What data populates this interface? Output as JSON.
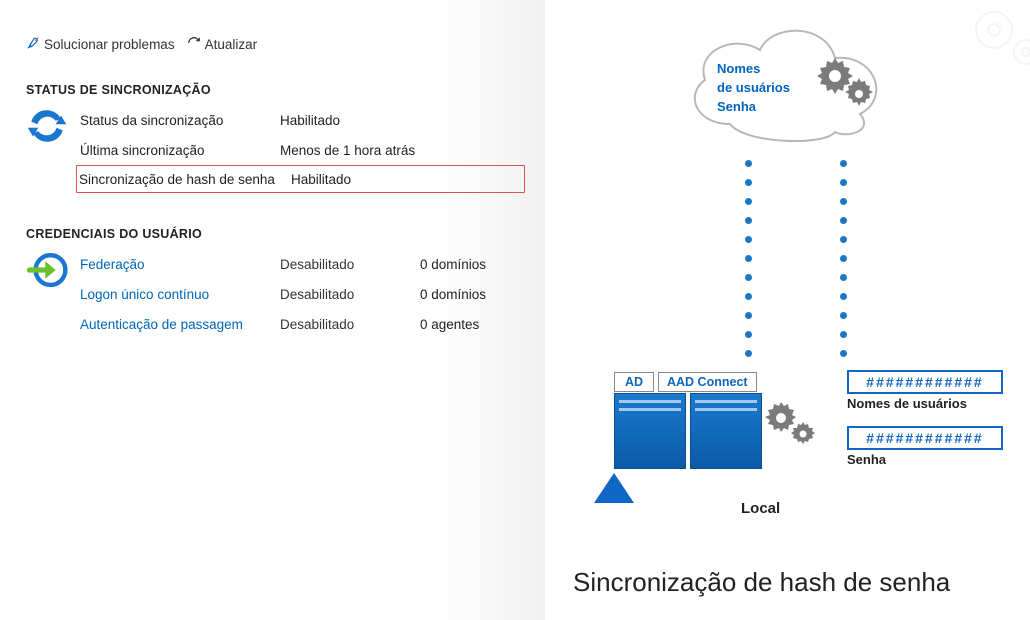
{
  "toolbar": {
    "troubleshoot": "Solucionar problemas",
    "refresh": "Atualizar"
  },
  "sync": {
    "heading": "STATUS DE SINCRONIZAÇÃO",
    "rows": [
      {
        "label": "Status da sincronização",
        "value": "Habilitado"
      },
      {
        "label": "Última sincronização",
        "value": "Menos de 1 hora atrás"
      },
      {
        "label": "Sincronização de hash de senha",
        "value": "Habilitado"
      }
    ]
  },
  "cred": {
    "heading": "CREDENCIAIS DO USUÁRIO",
    "rows": [
      {
        "label": "Federação",
        "value": "Desabilitado",
        "extra": "0 domínios"
      },
      {
        "label": "Logon único contínuo",
        "value": "Desabilitado",
        "extra": "0 domínios"
      },
      {
        "label": "Autenticação de passagem",
        "value": "Desabilitado",
        "extra": "0 agentes"
      }
    ]
  },
  "illustration": {
    "cloud_line1": "Nomes",
    "cloud_line2": "de usuários",
    "cloud_line3": "Senha",
    "server_ad": "AD",
    "server_aadc": "AAD Connect",
    "local": "Local",
    "hash": "############",
    "usernames_label": "Nomes de usuários",
    "password_label": "Senha",
    "caption": "Sincronização de hash de senha"
  }
}
